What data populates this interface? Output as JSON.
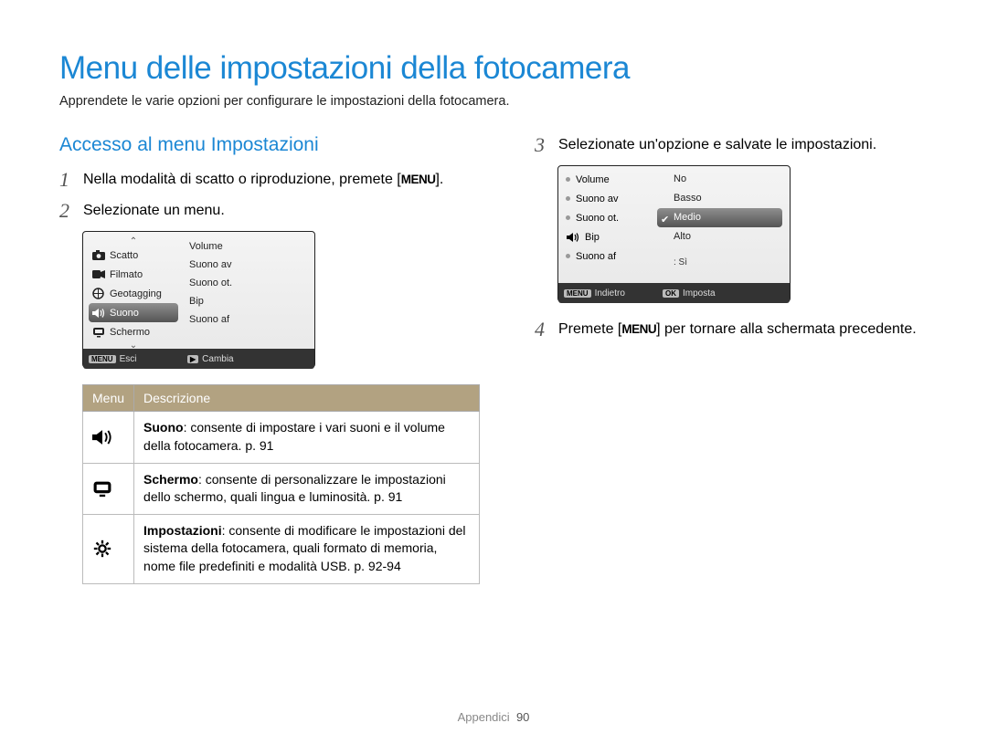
{
  "page": {
    "title": "Menu delle impostazioni della fotocamera",
    "subtitle": "Apprendete le varie opzioni per configurare le impostazioni della fotocamera."
  },
  "left": {
    "heading": "Accesso al menu Impostazioni",
    "step1_pre": "Nella modalità di scatto o riproduzione, premete [",
    "step1_key": "MENU",
    "step1_post": "].",
    "step2": "Selezionate un menu.",
    "step_num_1": "1",
    "step_num_2": "2"
  },
  "screen1": {
    "left_items": [
      {
        "icon": "camera-icon",
        "label": "Scatto"
      },
      {
        "icon": "video-icon",
        "label": "Filmato"
      },
      {
        "icon": "globe-icon",
        "label": "Geotagging"
      },
      {
        "icon": "speaker-icon",
        "label": "Suono",
        "selected": true
      },
      {
        "icon": "display-icon",
        "label": "Schermo"
      }
    ],
    "right_items": [
      "Volume",
      "Suono av",
      "Suono ot.",
      "Bip",
      "Suono af"
    ],
    "footer": {
      "left_key": "MENU",
      "left_label": "Esci",
      "right_key": "▶",
      "right_label": "Cambia"
    }
  },
  "table": {
    "th_menu": "Menu",
    "th_desc": "Descrizione",
    "rows": [
      {
        "icon": "speaker-icon",
        "title": "Suono",
        "desc": ": consente di impostare i vari suoni e il volume della fotocamera. p. 91"
      },
      {
        "icon": "display-icon",
        "title": "Schermo",
        "desc": ": consente di personalizzare le impostazioni dello schermo, quali lingua e luminosità. p. 91"
      },
      {
        "icon": "gear-icon",
        "title": "Impostazioni",
        "desc": ": consente di modificare le impostazioni del sistema della fotocamera, quali formato di memoria, nome file predefiniti e modalità USB. p. 92-94"
      }
    ]
  },
  "right": {
    "step3": "Selezionate un'opzione e salvate le impostazioni.",
    "step_num_3": "3",
    "step4_pre": "Premete [",
    "step4_key": "MENU",
    "step4_post": "] per tornare alla schermata precedente.",
    "step_num_4": "4"
  },
  "screen2": {
    "left_items": [
      "Volume",
      "Suono av",
      "Suono ot.",
      "Bip",
      "Suono af"
    ],
    "left_selected_icon_index": 3,
    "options": [
      {
        "label": "No"
      },
      {
        "label": "Basso"
      },
      {
        "label": "Medio",
        "selected": true,
        "checked": true
      },
      {
        "label": "Alto"
      }
    ],
    "sub_label": ": Sì",
    "footer": {
      "left_key": "MENU",
      "left_label": "Indietro",
      "right_key": "OK",
      "right_label": "Imposta"
    }
  },
  "footer": {
    "section": "Appendici",
    "page": "90"
  }
}
